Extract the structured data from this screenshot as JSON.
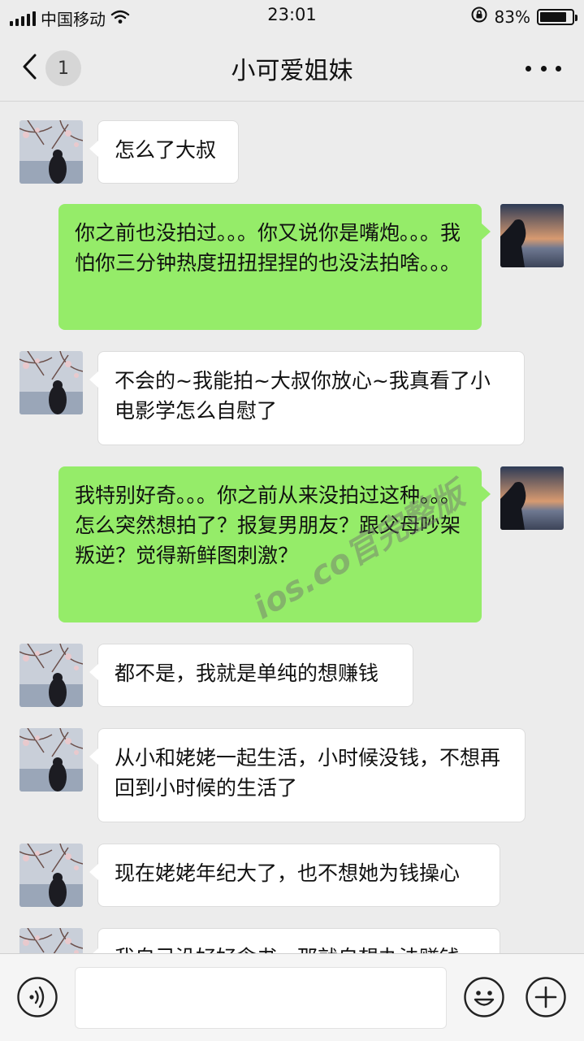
{
  "status_bar": {
    "carrier": "中国移动",
    "time": "23:01",
    "battery_percent": "83%",
    "battery_level": 0.83
  },
  "nav": {
    "back_badge": "1",
    "title": "小可爱姐妹"
  },
  "messages": [
    {
      "side": "in",
      "text": "怎么了大叔"
    },
    {
      "side": "out",
      "text": "你之前也没拍过。。。你又说你是嘴炮。。。我怕你三分钟热度扭扭捏捏的也没法拍啥。。。"
    },
    {
      "side": "in",
      "text": "不会的~我能拍~大叔你放心~我真看了小电影学怎么自慰了"
    },
    {
      "side": "out",
      "text": "我特别好奇。。。你之前从来没拍过这种。。。怎么突然想拍了？报复男朋友？跟父母吵架叛逆？觉得新鲜图刺激？"
    },
    {
      "side": "in",
      "text": "都不是，我就是单纯的想赚钱"
    },
    {
      "side": "in",
      "text": "从小和姥姥一起生活，小时候没钱，不想再回到小时候的生活了"
    },
    {
      "side": "in",
      "text": "现在姥姥年纪大了，也不想她为钱操心"
    },
    {
      "side": "in",
      "text": "我自己没好好念书，那就自想办法赚钱"
    }
  ],
  "watermark": "ios.co官完整版",
  "colors": {
    "background": "#ececec",
    "bubble_in": "#ffffff",
    "bubble_out": "#95ec69"
  }
}
